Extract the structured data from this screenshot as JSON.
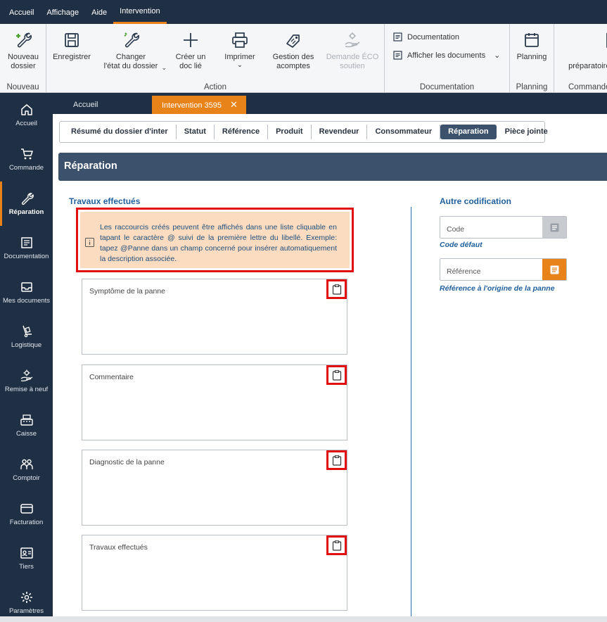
{
  "menu": {
    "items": [
      "Accueil",
      "Affichage",
      "Aide",
      "Intervention"
    ],
    "active": "Intervention"
  },
  "ribbon": {
    "nouveau": {
      "button": "Nouveau\ndossier",
      "group": "Nouveau"
    },
    "action": {
      "group": "Action",
      "enregistrer": "Enregistrer",
      "changer": "Changer\nl'état du dossier",
      "creer": "Créer un\ndoc lié",
      "imprimer": "Imprimer",
      "gestion": "Gestion des\nacomptes",
      "demande": "Demande ÉCO\nsoutien"
    },
    "documentation": {
      "group": "Documentation",
      "doc": "Documentation",
      "afficher": "Afficher les documents"
    },
    "planning": {
      "button": "Planning",
      "group": "Planning"
    },
    "commande": {
      "button": "E\npréparatoire c",
      "group": "Commande"
    }
  },
  "sidebar": {
    "items": [
      "Accueil",
      "Commande",
      "Réparation",
      "Documentation",
      "Mes documents",
      "Logistique",
      "Remise à neuf",
      "Caisse",
      "Comptoir",
      "Facturation",
      "Tiers",
      "Paramètres"
    ],
    "active": "Réparation"
  },
  "doc_tabs": {
    "home": "Accueil",
    "current": "Intervention 3595",
    "close": "✕"
  },
  "sub_tabs": [
    "Résumé du dossier d'inter",
    "Statut",
    "Référence",
    "Produit",
    "Revendeur",
    "Consommateur",
    "Réparation",
    "Pièce jointe"
  ],
  "active_sub_tab": "Réparation",
  "section_title": "Réparation",
  "left": {
    "heading": "Travaux effectués",
    "info": "Les raccourcis créés peuvent être affichés dans une liste cliquable en tapant le caractère @ suivi de la première lettre du libellé. Exemple: tapez @Panne dans un champ concerné pour insérer automatiquement la description associée.",
    "fields": [
      "Symptôme de la panne",
      "Commentaire",
      "Diagnostic de la panne",
      "Travaux effectués"
    ]
  },
  "right": {
    "heading": "Autre codification",
    "code_placeholder": "Code",
    "code_note": "Code défaut",
    "ref_placeholder": "Référence",
    "ref_note": "Référence à l'origine de la panne"
  },
  "colors": {
    "navy": "#1f2f44",
    "accent": "#e8831a",
    "section": "#3c516b",
    "link": "#1f5f9c",
    "highlight": "#e10f0f",
    "info_bg": "#fbdcc0"
  }
}
